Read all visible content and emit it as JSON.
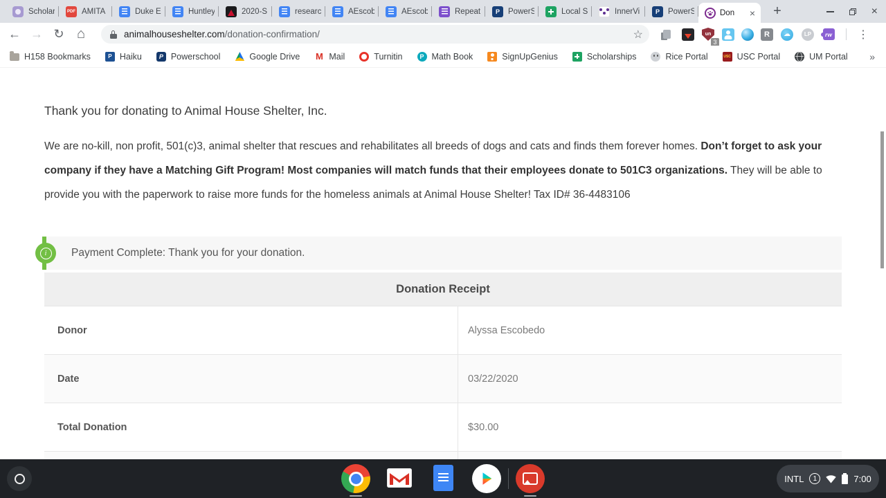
{
  "glyphs": {
    "back": "←",
    "forward": "→",
    "reload": "↻",
    "home": "⌂",
    "star": "☆",
    "kebab": "⋮",
    "plus": "+",
    "close": "×",
    "overflow": "»",
    "cloud": "☁",
    "info": "i"
  },
  "browser": {
    "tabs": [
      {
        "label": "Scholar"
      },
      {
        "label": "AMITA",
        "glyph": "PDF"
      },
      {
        "label": "Duke E"
      },
      {
        "label": "Huntley"
      },
      {
        "label": "2020-S"
      },
      {
        "label": "researc"
      },
      {
        "label": "AEscob"
      },
      {
        "label": "AEscob"
      },
      {
        "label": "Repeat"
      },
      {
        "label": "PowerS",
        "glyph": "P"
      },
      {
        "label": "Local S"
      },
      {
        "label": "InnerVi"
      },
      {
        "label": "PowerS",
        "glyph": "P"
      }
    ],
    "active_tab": {
      "label": "Don"
    },
    "address": {
      "domain": "animalhouseshelter.com",
      "path": "/donation-confirmation/"
    },
    "extensions": {
      "shield_glyph": "un",
      "shield_badge": "3",
      "r_glyph": "R",
      "lastpass_glyph": "LP",
      "readwrite_glyph": "rw"
    },
    "bookmarks": [
      {
        "label": "H158 Bookmarks"
      },
      {
        "label": "Haiku",
        "glyph": "P"
      },
      {
        "label": "Powerschool",
        "glyph": "P"
      },
      {
        "label": "Google Drive"
      },
      {
        "label": "Mail",
        "glyph": "M"
      },
      {
        "label": "Turnitin"
      },
      {
        "label": "Math Book",
        "glyph": "P"
      },
      {
        "label": "SignUpGenius"
      },
      {
        "label": "Scholarships"
      },
      {
        "label": "Rice Portal"
      },
      {
        "label": "USC Portal",
        "glyph": "USC"
      },
      {
        "label": "UM Portal"
      }
    ]
  },
  "page": {
    "intro": "Thank you for donating to Animal House Shelter, Inc.",
    "paragraph": {
      "normal1": "We are no-kill, non profit, 501(c)3, animal shelter that rescues and rehabilitates all breeds of dogs and cats and finds them forever homes. ",
      "bold": "Don’t forget to ask your company if they have a Matching Gift Program! Most companies will match funds that their employees donate to 501C3 organizations.",
      "normal2": " They will be able to provide you with the paperwork to raise more funds for the homeless animals at Animal House Shelter! Tax ID# 36-4483106"
    },
    "notice": "Payment Complete: Thank you for your donation.",
    "receipt": {
      "title": "Donation Receipt",
      "rows": [
        {
          "label": "Donor",
          "value": "Alyssa Escobedo"
        },
        {
          "label": "Date",
          "value": "03/22/2020"
        },
        {
          "label": "Total Donation",
          "value": "$30.00"
        }
      ]
    },
    "colors": {
      "notice_green": "#72bf44"
    }
  },
  "shelf": {
    "status": {
      "input_method": "INTL",
      "notification_count": "1",
      "time": "7:00"
    }
  }
}
